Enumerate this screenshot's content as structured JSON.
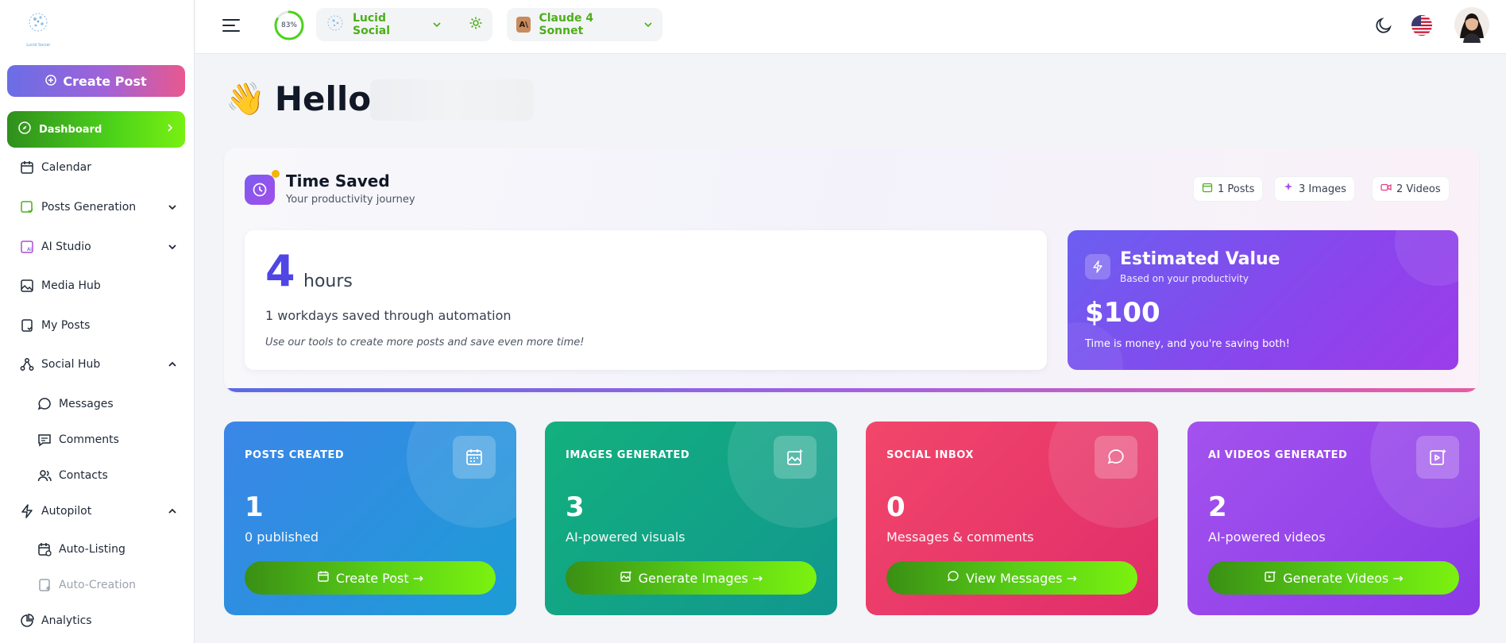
{
  "sidebar": {
    "logo_text": "Lucid Social",
    "create_post_label": "Create Post",
    "dashboard_label": "Dashboard",
    "items": [
      {
        "label": "Calendar"
      },
      {
        "label": "Posts Generation"
      },
      {
        "label": "AI Studio"
      },
      {
        "label": "Media Hub"
      },
      {
        "label": "My Posts"
      },
      {
        "label": "Social Hub"
      },
      {
        "label": "Messages"
      },
      {
        "label": "Comments"
      },
      {
        "label": "Contacts"
      },
      {
        "label": "Autopilot"
      },
      {
        "label": "Auto-Listing"
      },
      {
        "label": "Auto-Creation"
      },
      {
        "label": "Analytics"
      }
    ]
  },
  "topbar": {
    "progress_label": "83%",
    "progress_value": 0.83,
    "workspace_label": "Lucid Social",
    "model_label": "Claude 4 Sonnet",
    "model_badge": "A\\"
  },
  "greeting": {
    "emoji": "👋",
    "text": "Hello,"
  },
  "time_saved": {
    "title": "Time Saved",
    "subtitle": "Your productivity journey",
    "chips": [
      "1 Posts",
      "3 Images",
      "2 Videos"
    ],
    "hours_value": "4",
    "hours_unit": "hours",
    "workdays_text": "1 workdays saved through automation",
    "hint": "Use our tools to create more posts and save even more time!"
  },
  "estimated_value": {
    "title": "Estimated Value",
    "subtitle": "Based on your productivity",
    "amount": "$100",
    "note": "Time is money, and you're saving both!"
  },
  "stats": [
    {
      "title": "POSTS CREATED",
      "value": "1",
      "desc": "0 published",
      "button": "Create Post →",
      "icon": "calendar-icon",
      "color": "#3b86e8"
    },
    {
      "title": "IMAGES GENERATED",
      "value": "3",
      "desc": "AI-powered visuals",
      "button": "Generate Images →",
      "icon": "image-sparkle-icon",
      "color": "#13b07d"
    },
    {
      "title": "SOCIAL INBOX",
      "value": "0",
      "desc": "Messages & comments",
      "button": "View Messages →",
      "icon": "chat-bubble-icon",
      "color": "#f2466a"
    },
    {
      "title": "AI VIDEOS GENERATED",
      "value": "2",
      "desc": "AI-powered videos",
      "button": "Generate Videos →",
      "icon": "video-sparkle-icon",
      "color": "#a352ee"
    }
  ],
  "colors": {
    "accent_green": "#4caf1a",
    "accent_purple": "#7c5cf0"
  }
}
